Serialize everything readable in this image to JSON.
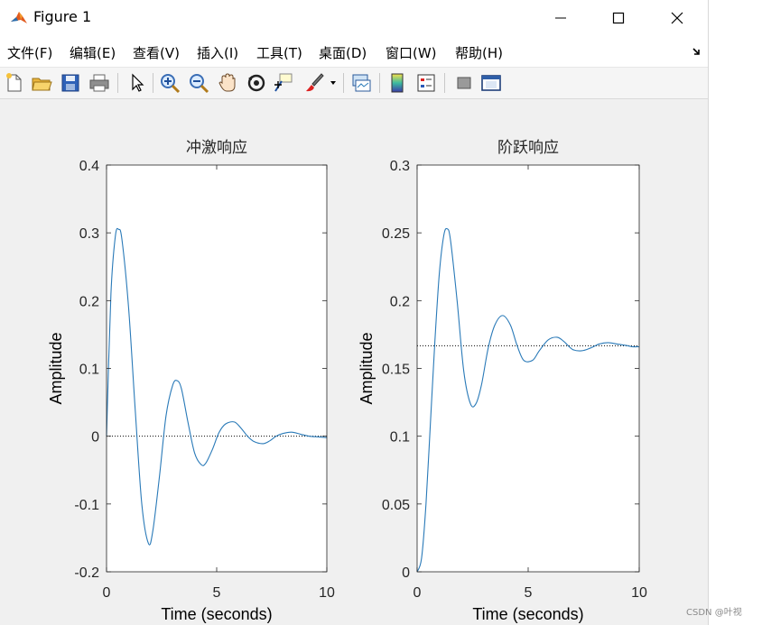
{
  "window": {
    "title": "Figure 1",
    "minimize_icon": "minimize-icon",
    "maximize_icon": "maximize-icon",
    "close_icon": "close-icon"
  },
  "menu": {
    "items": [
      "文件(F)",
      "编辑(E)",
      "查看(V)",
      "插入(I)",
      "工具(T)",
      "桌面(D)",
      "窗口(W)",
      "帮助(H)"
    ]
  },
  "toolbar": {
    "icons": [
      "new-figure-icon",
      "open-file-icon",
      "save-icon",
      "print-icon",
      "pointer-icon",
      "zoom-in-icon",
      "zoom-out-icon",
      "pan-hand-icon",
      "rotate-3d-icon",
      "data-cursor-icon",
      "brush-icon",
      "brush-dropdown-icon",
      "link-plot-icon",
      "colorbar-icon",
      "legend-icon",
      "hide-plot-tools-icon",
      "show-plot-tools-icon"
    ]
  },
  "watermark": "CSDN @叶视",
  "chart_data": [
    {
      "type": "line",
      "title": "冲激响应",
      "xlabel": "Time (seconds)",
      "ylabel": "Amplitude",
      "xlim": [
        0,
        10
      ],
      "ylim": [
        -0.2,
        0.4
      ],
      "xticks": [
        "0",
        "5",
        "10"
      ],
      "yticks": [
        "-0.2",
        "-0.1",
        "0",
        "0.1",
        "0.2",
        "0.3",
        "0.4"
      ],
      "reference_line": 0,
      "grid": false,
      "series": [
        {
          "color": "#2a7ab8",
          "x": [
            0,
            0.2,
            0.4,
            0.55,
            0.7,
            1.0,
            1.3,
            1.6,
            1.9,
            2.1,
            2.4,
            2.7,
            3.0,
            3.2,
            3.4,
            3.7,
            4.0,
            4.3,
            4.5,
            4.8,
            5.1,
            5.4,
            5.8,
            6.1,
            6.4,
            6.7,
            7.1,
            7.4,
            7.7,
            8.0,
            8.4,
            8.8,
            9.2,
            9.6,
            10.0
          ],
          "y": [
            0,
            0.21,
            0.295,
            0.305,
            0.29,
            0.19,
            0.04,
            -0.1,
            -0.158,
            -0.14,
            -0.06,
            0.03,
            0.075,
            0.082,
            0.07,
            0.02,
            -0.025,
            -0.042,
            -0.04,
            -0.02,
            0.005,
            0.018,
            0.021,
            0.012,
            0.0,
            -0.008,
            -0.011,
            -0.007,
            0.0,
            0.004,
            0.006,
            0.003,
            0.0,
            -0.001,
            -0.002
          ]
        }
      ]
    },
    {
      "type": "line",
      "title": "阶跃响应",
      "xlabel": "Time (seconds)",
      "ylabel": "Amplitude",
      "xlim": [
        0,
        10
      ],
      "ylim": [
        0,
        0.3
      ],
      "xticks": [
        "0",
        "5",
        "10"
      ],
      "yticks": [
        "0",
        "0.05",
        "0.1",
        "0.15",
        "0.2",
        "0.25",
        "0.3"
      ],
      "reference_line": 0.1667,
      "grid": false,
      "series": [
        {
          "color": "#2a7ab8",
          "x": [
            0,
            0.2,
            0.4,
            0.6,
            0.8,
            1.0,
            1.2,
            1.35,
            1.5,
            1.8,
            2.1,
            2.4,
            2.65,
            2.9,
            3.2,
            3.5,
            3.85,
            4.2,
            4.5,
            4.8,
            5.2,
            5.5,
            5.9,
            6.3,
            6.6,
            7.0,
            7.4,
            7.8,
            8.2,
            8.6,
            9.0,
            9.4,
            9.7,
            10.0
          ],
          "y": [
            0,
            0.01,
            0.05,
            0.11,
            0.17,
            0.22,
            0.248,
            0.253,
            0.245,
            0.2,
            0.148,
            0.124,
            0.124,
            0.138,
            0.165,
            0.182,
            0.189,
            0.182,
            0.167,
            0.156,
            0.156,
            0.163,
            0.171,
            0.173,
            0.17,
            0.164,
            0.163,
            0.165,
            0.168,
            0.169,
            0.168,
            0.167,
            0.166,
            0.166
          ]
        }
      ]
    }
  ]
}
